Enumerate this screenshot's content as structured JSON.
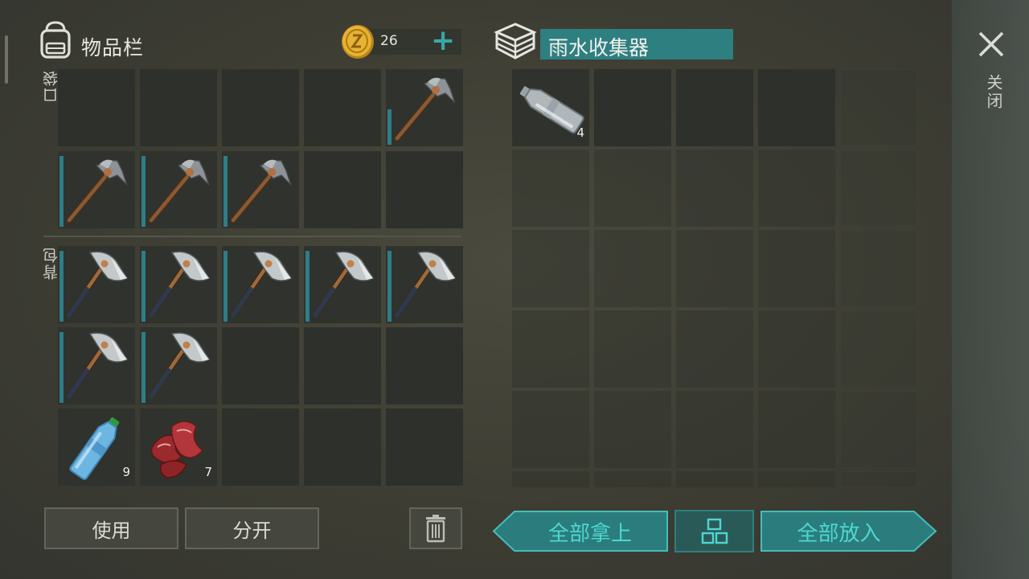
{
  "inventory": {
    "title": "物品栏",
    "coins": "26",
    "pocket_label": "口袋",
    "backpack_label": "背包",
    "pocket_slots": [
      {
        "item": "",
        "qty": ""
      },
      {
        "item": "",
        "qty": ""
      },
      {
        "item": "",
        "qty": ""
      },
      {
        "item": "",
        "qty": ""
      },
      {
        "item": "stone-pickaxe",
        "qty": "",
        "durability": 0.5
      },
      {
        "item": "stone-pickaxe",
        "qty": "",
        "durability": 1.0
      },
      {
        "item": "stone-pickaxe",
        "qty": "",
        "durability": 1.0
      },
      {
        "item": "stone-pickaxe",
        "qty": "",
        "durability": 1.0
      },
      {
        "item": "",
        "qty": ""
      },
      {
        "item": "",
        "qty": ""
      }
    ],
    "backpack_slots": [
      {
        "item": "iron-hatchet",
        "qty": "",
        "durability": 1.0
      },
      {
        "item": "iron-hatchet",
        "qty": "",
        "durability": 1.0
      },
      {
        "item": "iron-hatchet",
        "qty": "",
        "durability": 1.0
      },
      {
        "item": "iron-hatchet",
        "qty": "",
        "durability": 1.0
      },
      {
        "item": "iron-hatchet",
        "qty": "",
        "durability": 1.0
      },
      {
        "item": "iron-hatchet",
        "qty": "",
        "durability": 1.0
      },
      {
        "item": "iron-hatchet",
        "qty": "",
        "durability": 1.0
      },
      {
        "item": "",
        "qty": ""
      },
      {
        "item": "",
        "qty": ""
      },
      {
        "item": "",
        "qty": ""
      },
      {
        "item": "water-bottle",
        "qty": "9"
      },
      {
        "item": "raw-meat",
        "qty": "7"
      },
      {
        "item": "",
        "qty": ""
      },
      {
        "item": "",
        "qty": ""
      },
      {
        "item": "",
        "qty": ""
      }
    ],
    "use_label": "使用",
    "split_label": "分开"
  },
  "container": {
    "title": "雨水收集器",
    "first_item": {
      "item": "empty-bottle",
      "qty": "4"
    },
    "take_all_label": "全部拿上",
    "put_all_label": "全部放入"
  },
  "close_label": "关闭",
  "colors": {
    "accent": "#36a8a6",
    "title_bar": "#2e7f80",
    "durability": "#2f7d86"
  }
}
